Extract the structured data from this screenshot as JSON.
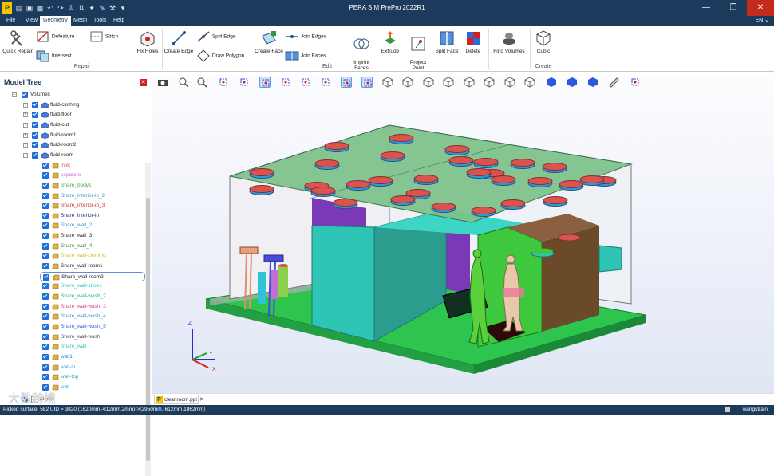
{
  "window": {
    "title": "PERA SIM PrePro 2022R1",
    "minimize": "—",
    "restore": "❐",
    "close": "✕"
  },
  "menu": [
    "File",
    "View",
    "Geometry",
    "Mesh",
    "Tools",
    "Help"
  ],
  "active_menu": "Geometry",
  "language": "EN ⌄",
  "ribbon": {
    "repair": {
      "quick_repair": "Quick Repair",
      "defeature": "Defeature",
      "stitch": "Stitch",
      "intersect": "Intersect",
      "fix_holes": "Fix Holes",
      "group": "Repair"
    },
    "edit": {
      "create_edge": "Create Edge",
      "split_edge": "Split Edge",
      "draw_polygon": "Draw Polygon",
      "create_face": "Create Face",
      "join_edges": "Join Edges",
      "join_faces": "Join Faces",
      "imprint_faces": "Imprint\nFaces",
      "extrude": "Extrude",
      "project_point": "Project\nPoint",
      "split_face": "Split Face",
      "delete": "Delete",
      "group": "Edit"
    },
    "find": {
      "find_volumes": "Find Volumes"
    },
    "create": {
      "cubic": "Cubic",
      "group": "Create"
    }
  },
  "model_tree": {
    "title": "Model Tree",
    "items": [
      {
        "label": "Volumes",
        "level": 0,
        "expander": "−",
        "icon": "volumes-icon",
        "color": "#222222"
      },
      {
        "label": "fluid-clothing",
        "level": 1,
        "expander": "+",
        "icon": "volume-icon",
        "color": "#222222"
      },
      {
        "label": "fluid-floor",
        "level": 1,
        "expander": "+",
        "icon": "volume-icon",
        "color": "#222222"
      },
      {
        "label": "fluid-out",
        "level": 1,
        "expander": "+",
        "icon": "volume-icon",
        "color": "#222222"
      },
      {
        "label": "fluid-room1",
        "level": 1,
        "expander": "+",
        "icon": "volume-icon",
        "color": "#222222"
      },
      {
        "label": "fluid-room2",
        "level": 1,
        "expander": "+",
        "icon": "volume-icon",
        "color": "#222222"
      },
      {
        "label": "fluid-room",
        "level": 1,
        "expander": "−",
        "icon": "volume-icon",
        "color": "#222222"
      },
      {
        "label": "inlet",
        "level": 2,
        "icon": "face-icon",
        "color": "#d9534f"
      },
      {
        "label": "sepatare",
        "level": 2,
        "icon": "face-icon",
        "color": "#c070d0"
      },
      {
        "label": "Share_body1",
        "level": 2,
        "icon": "face-icon",
        "color": "#40b040"
      },
      {
        "label": "Share_interior-in_2",
        "level": 2,
        "icon": "face-icon",
        "color": "#3a9ad9"
      },
      {
        "label": "Share_interior-in_3",
        "level": 2,
        "icon": "face-icon",
        "color": "#d03030"
      },
      {
        "label": "Share_interior-in",
        "level": 2,
        "icon": "face-icon",
        "color": "#2a2a7a"
      },
      {
        "label": "Share_wall_2",
        "level": 2,
        "icon": "face-icon",
        "color": "#3a9ad9"
      },
      {
        "label": "Share_wall_3",
        "level": 2,
        "icon": "face-icon",
        "color": "#333333"
      },
      {
        "label": "Share_wall_4",
        "level": 2,
        "icon": "face-icon",
        "color": "#4a8a4a"
      },
      {
        "label": "Share_wall-clothing",
        "level": 2,
        "icon": "face-icon",
        "color": "#c8c830"
      },
      {
        "label": "Share_wall-room1",
        "level": 2,
        "icon": "face-icon",
        "color": "#333333"
      },
      {
        "label": "Share_wall-room2",
        "level": 2,
        "icon": "face-icon",
        "color": "#222222",
        "selected": true
      },
      {
        "label": "Share_wall-shoes",
        "level": 2,
        "icon": "face-icon",
        "color": "#40c0c0"
      },
      {
        "label": "Share_wall-wash_2",
        "level": 2,
        "icon": "face-icon",
        "color": "#30b070"
      },
      {
        "label": "Share_wall-wash_3",
        "level": 2,
        "icon": "face-icon",
        "color": "#e04090"
      },
      {
        "label": "Share_wall-wash_4",
        "level": 2,
        "icon": "face-icon",
        "color": "#3a9ad9"
      },
      {
        "label": "Share_wall-wash_5",
        "level": 2,
        "icon": "face-icon",
        "color": "#3a6ad9"
      },
      {
        "label": "Share_wall-wash",
        "level": 2,
        "icon": "face-icon",
        "color": "#555555"
      },
      {
        "label": "Share_wall",
        "level": 2,
        "icon": "face-icon",
        "color": "#40c0c0"
      },
      {
        "label": "wall1",
        "level": 2,
        "icon": "face-icon",
        "color": "#2a7ad9"
      },
      {
        "label": "wall-in",
        "level": 2,
        "icon": "face-icon",
        "color": "#3a9ad9"
      },
      {
        "label": "wall-top",
        "level": 2,
        "icon": "face-icon",
        "color": "#30a0a0"
      },
      {
        "label": "wall",
        "level": 2,
        "icon": "face-icon",
        "color": "#3a9ad9"
      },
      {
        "label": "Mesh",
        "level": 0,
        "icon": "mesh-icon",
        "color": "#222222"
      }
    ]
  },
  "viewport": {
    "axis_z": "Z",
    "axis_y": "Y",
    "axis_x": "X"
  },
  "doc_tab": "cleanroom.ppi",
  "watermark": "大数跨境",
  "status": {
    "left": "Picked surface: 582 UID = 3820 (1620mm,-612mm,2mm)->(2950mm,-612mm,1862mm)",
    "user": "wangstrain"
  },
  "colors": {
    "titlebar": "#1b3a5c",
    "accent": "#1f6fd6",
    "floor": "#22c55e",
    "roof": "#7cc28a",
    "wall": "#2ec4b6",
    "disc": "#d9534f"
  }
}
